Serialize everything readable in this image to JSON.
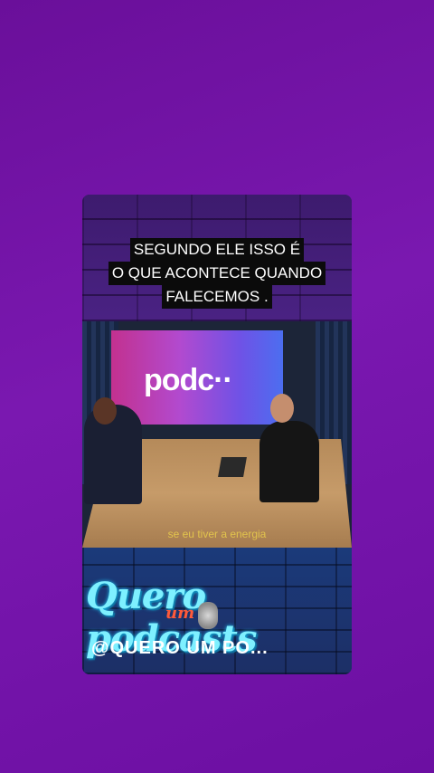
{
  "caption": {
    "lines": [
      "SEGUNDO ELE ISSO É",
      "O QUE ACONTECE QUANDO",
      "FALECEMOS ."
    ]
  },
  "video": {
    "screen_logo": "podc··",
    "subtitle": "se eu tiver a energia"
  },
  "branding": {
    "logo_text": "Quero  podcasts",
    "logo_um": "um",
    "handle": "@QUERO UM PO..."
  },
  "colors": {
    "background": "#7a18b0",
    "caption_bg": "#0b0b0b",
    "caption_text": "#ffffff",
    "logo_cyan": "#7ef0ff"
  }
}
